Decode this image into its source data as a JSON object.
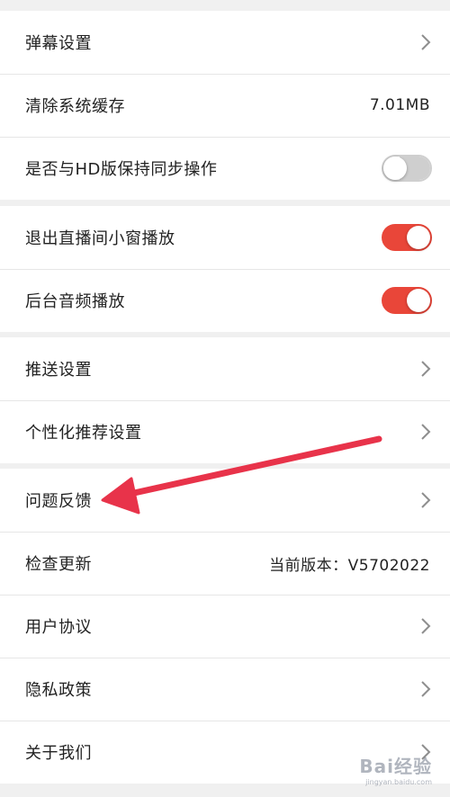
{
  "groups": [
    {
      "rows": [
        {
          "label": "弹幕设置",
          "type": "chevron"
        },
        {
          "label": "清除系统缓存",
          "type": "value",
          "value": "7.01MB"
        },
        {
          "label": "是否与HD版保持同步操作",
          "type": "toggle",
          "on": false
        }
      ]
    },
    {
      "rows": [
        {
          "label": "退出直播间小窗播放",
          "type": "toggle",
          "on": true
        },
        {
          "label": "后台音频播放",
          "type": "toggle",
          "on": true
        }
      ]
    },
    {
      "rows": [
        {
          "label": "推送设置",
          "type": "chevron"
        },
        {
          "label": "个性化推荐设置",
          "type": "chevron"
        }
      ]
    },
    {
      "rows": [
        {
          "label": "问题反馈",
          "type": "chevron"
        },
        {
          "label": "检查更新",
          "type": "value",
          "value": "当前版本：V5702022"
        },
        {
          "label": "用户协议",
          "type": "chevron"
        },
        {
          "label": "隐私政策",
          "type": "chevron"
        },
        {
          "label": "关于我们",
          "type": "chevron"
        }
      ]
    }
  ],
  "colors": {
    "accent": "#e94639",
    "annotation_arrow": "#e8334a",
    "background": "#f0f0f0",
    "surface": "#ffffff"
  },
  "annotation": {
    "icon": "red-arrow-pointing-left",
    "target": "问题反馈"
  },
  "watermark": {
    "text": "Bai经验",
    "sub": "jingyan.baidu.com"
  }
}
